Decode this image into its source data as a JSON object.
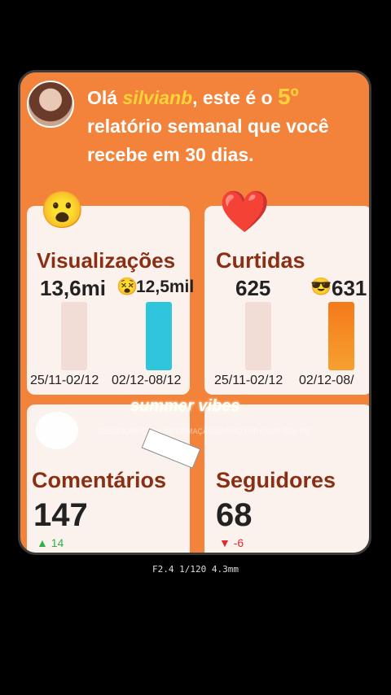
{
  "header": {
    "greeting_prefix": "Olá ",
    "username": "silvianb",
    "greeting_mid": ", este é o ",
    "report_number": "5º",
    "greeting_suffix": "relatório semanal que você recebe em 30 dias."
  },
  "cards": {
    "views": {
      "emoji": "😮",
      "title": "Visualizações",
      "current": "13,6mi",
      "previous": "12,5mil",
      "previous_emoji": "😵",
      "date_prev": "25/11-02/12",
      "date_curr": "02/12-08/12",
      "bar_prev_color": "#f1ddd5",
      "bar_curr_color": "#2ec5dd"
    },
    "likes": {
      "emoji": "❤️",
      "title": "Curtidas",
      "previous": "625",
      "current": "631",
      "current_emoji": "😎",
      "date_prev": "25/11-02/12",
      "date_curr": "02/12-08/",
      "bar_prev_color": "#f1ddd5",
      "bar_curr_color": "#f47a1a"
    },
    "comments": {
      "title": "Comentários",
      "value": "147",
      "delta": "14",
      "delta_icon": "▲",
      "delta_color": "#2db24a"
    },
    "followers": {
      "title": "Seguidores",
      "value": "68",
      "delta": "-6",
      "delta_icon": "▼",
      "delta_color": "#e0282e"
    }
  },
  "overlay": {
    "caption": "summer vibes",
    "faint_text": "SELECIONE CADA INFORMAÇÃO ABAIXO PARA VER SEU RELATÓRIO SEMANAL COMPLETO",
    "camera_info": "F2.4 1/120 4.3mm"
  }
}
